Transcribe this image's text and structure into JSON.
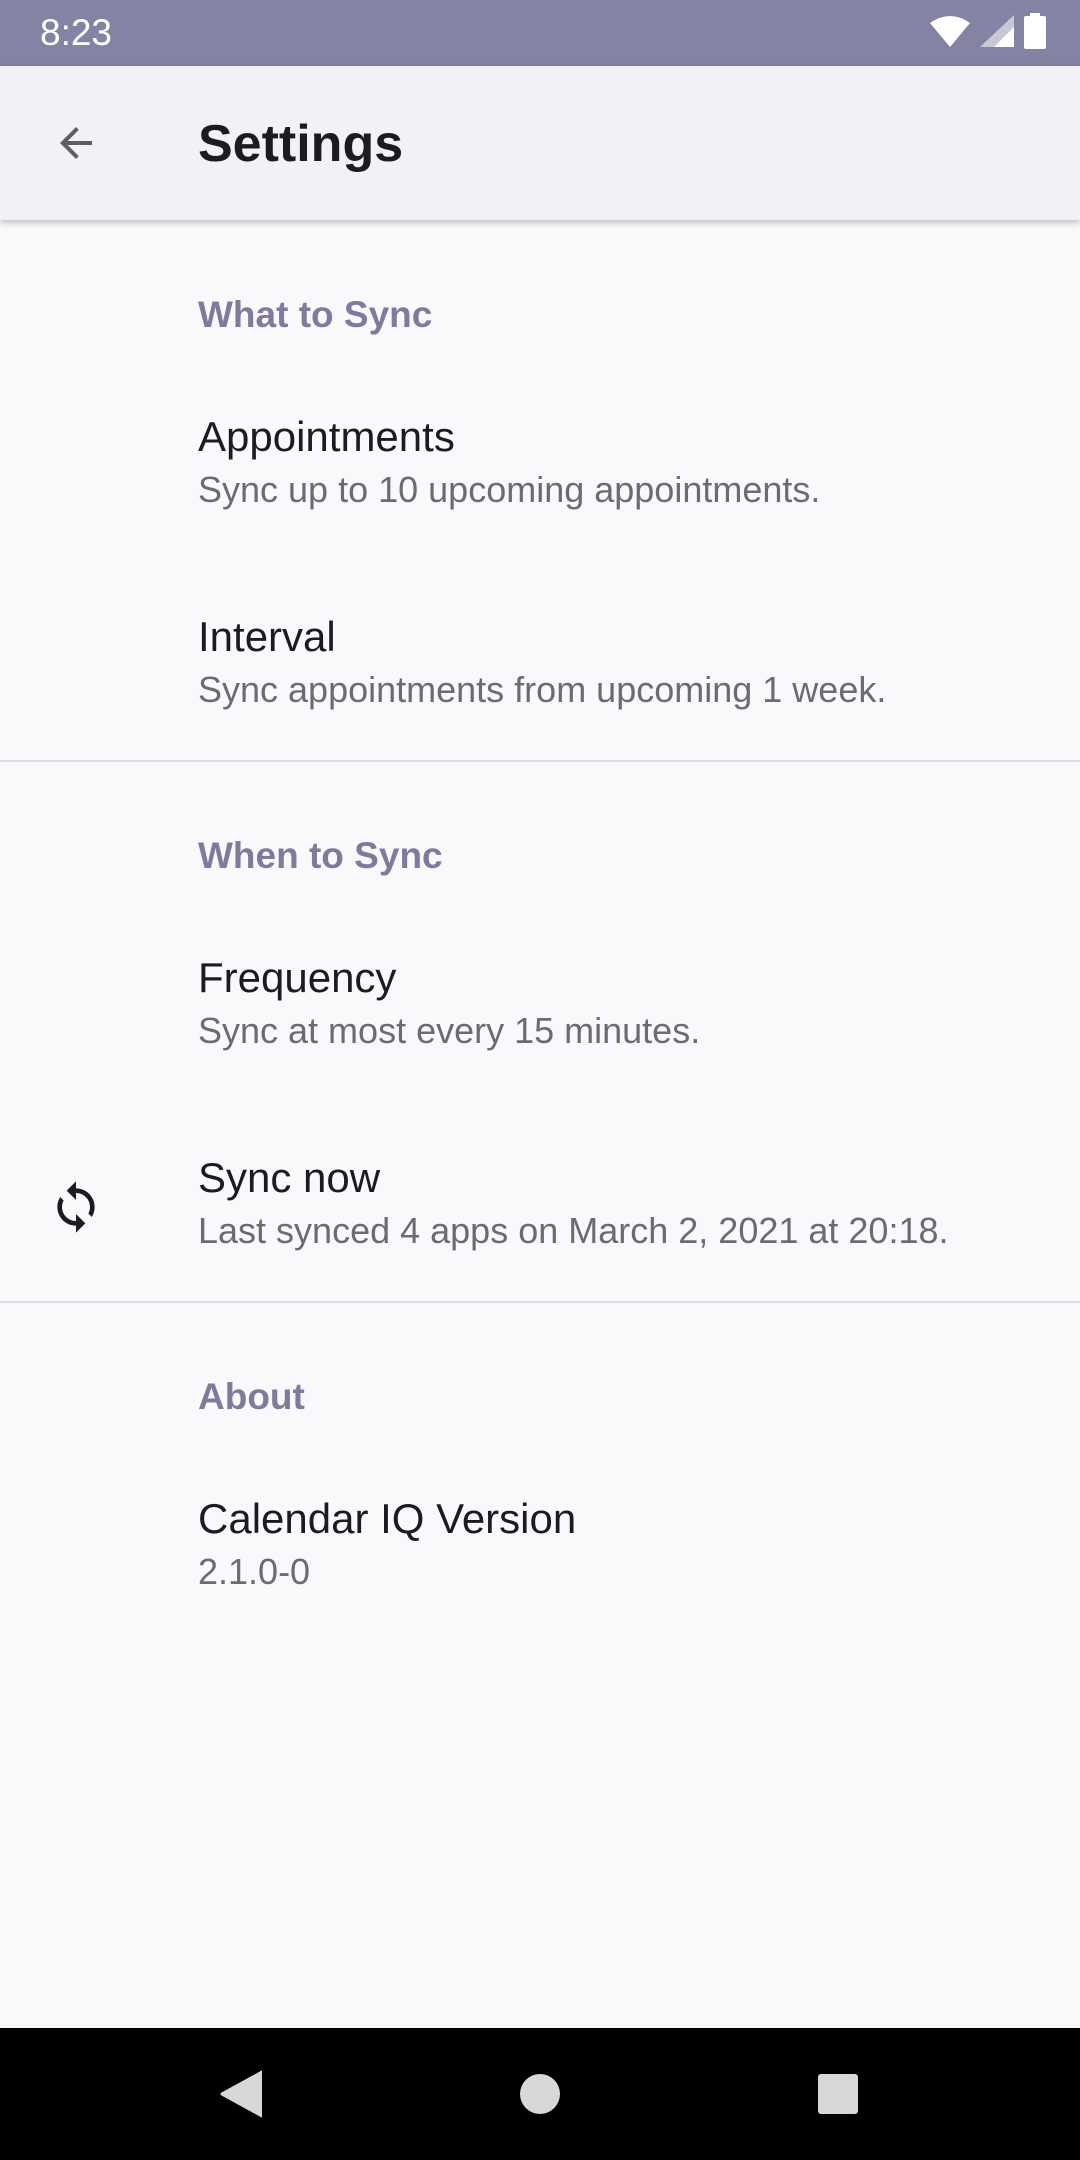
{
  "status_bar": {
    "time": "8:23",
    "icons": [
      "wifi-icon",
      "cellular-signal-icon",
      "battery-icon"
    ]
  },
  "app_bar": {
    "title": "Settings",
    "back_icon": "arrow-back-icon"
  },
  "sections": {
    "what_to_sync": {
      "header": "What to Sync",
      "appointments": {
        "title": "Appointments",
        "summary": "Sync up to 10 upcoming appointments."
      },
      "interval": {
        "title": "Interval",
        "summary": "Sync appointments from upcoming 1 week."
      }
    },
    "when_to_sync": {
      "header": "When to Sync",
      "frequency": {
        "title": "Frequency",
        "summary": "Sync at most every 15 minutes."
      },
      "sync_now": {
        "title": "Sync now",
        "summary": "Last synced 4 apps on March 2, 2021 at 20:18.",
        "icon": "sync-icon"
      }
    },
    "about": {
      "header": "About",
      "version": {
        "title": "Calendar IQ Version",
        "summary": "2.1.0-0"
      }
    }
  },
  "nav_bar": {
    "buttons": [
      "back-triangle-icon",
      "home-circle-icon",
      "recents-square-icon"
    ]
  },
  "colors": {
    "status_bar": "#8583a3",
    "app_bar": "#f2f1f6",
    "section_header": "#7e7b9c",
    "background": "#f9f9fb"
  }
}
